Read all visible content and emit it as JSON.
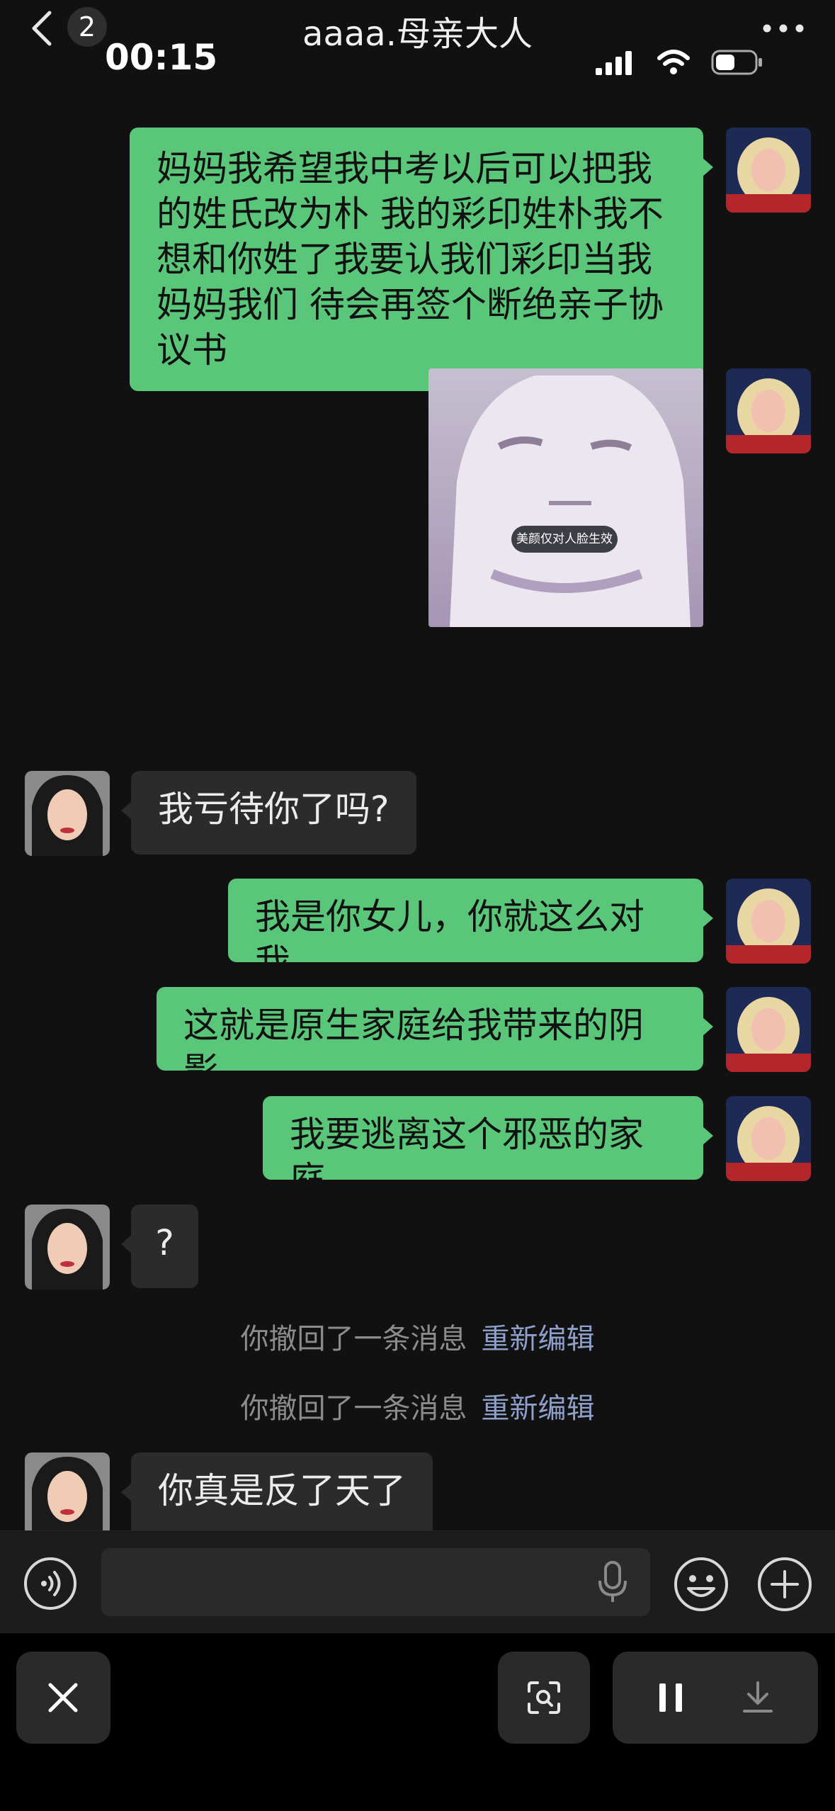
{
  "header": {
    "back_badge": "2",
    "time": "00:15",
    "title": "aaaa.母亲大人"
  },
  "messages": {
    "m1": "妈妈我希望我中考以后可以把我的姓氏改为朴 我的彩印姓朴我不想和你姓了我要认我们彩印当我妈妈我们 待会再签个断绝亲子协议书",
    "photo_caption": "美颜仅对人脸生效",
    "m2": "我亏待你了吗?",
    "m3": "我是你女儿，你就这么对我",
    "m4": "这就是原生家庭给我带来的阴影",
    "m5": "我要逃离这个邪恶的家庭",
    "m6": "?",
    "m7": "你真是反了天了"
  },
  "system": [
    {
      "text": "你撤回了一条消息",
      "action": "重新编辑"
    },
    {
      "text": "你撤回了一条消息",
      "action": "重新编辑"
    }
  ],
  "colors": {
    "background": "#111111",
    "my_bubble": "#5ac679",
    "their_bubble": "#2b2b2b",
    "link": "#8e9fca"
  },
  "icons": {
    "voice": "voice-icon",
    "mic": "microphone-icon",
    "emoji": "emoji-icon",
    "plus": "plus-icon",
    "close": "close-icon",
    "scan": "scan-icon",
    "pause": "pause-icon",
    "download": "download-icon"
  }
}
